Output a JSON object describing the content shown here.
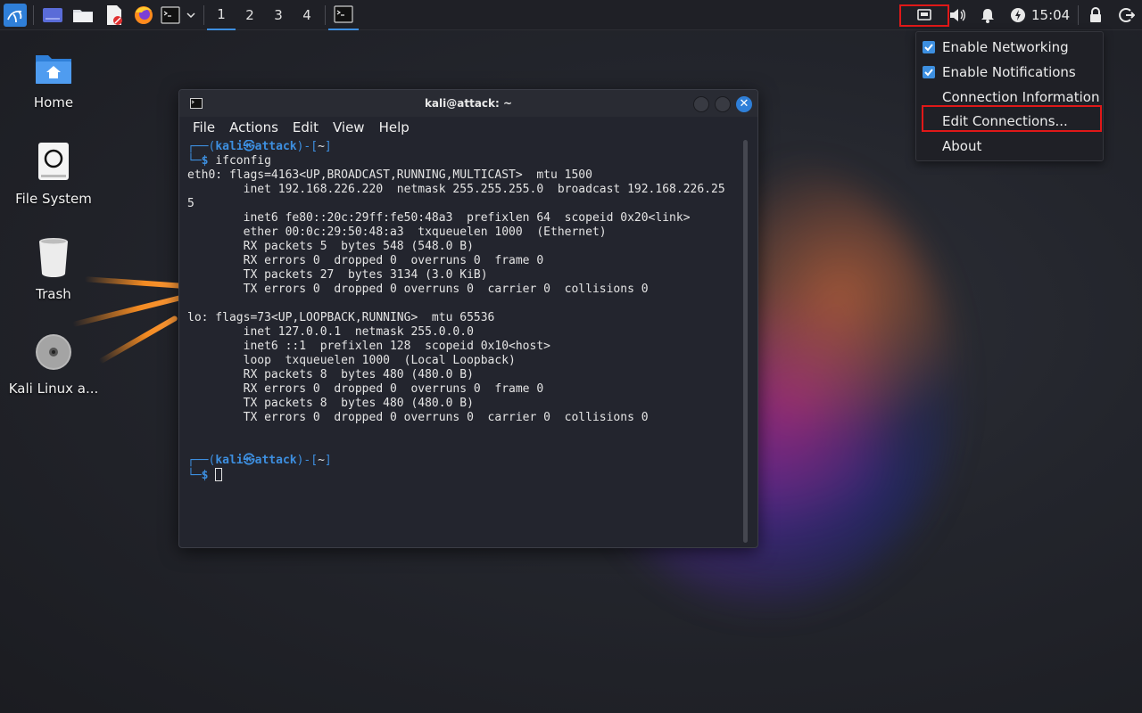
{
  "panel": {
    "workspaces": [
      "1",
      "2",
      "3",
      "4"
    ],
    "active_workspace": "1",
    "clock": "15:04"
  },
  "desktop": {
    "icons": [
      {
        "label": "Home",
        "icon": "home-folder-icon"
      },
      {
        "label": "File System",
        "icon": "drive-icon"
      },
      {
        "label": "Trash",
        "icon": "trash-icon"
      },
      {
        "label": "Kali Linux a...",
        "icon": "disc-icon"
      }
    ]
  },
  "terminal": {
    "title": "kali@attack: ~",
    "menu": [
      "File",
      "Actions",
      "Edit",
      "View",
      "Help"
    ],
    "prompt": {
      "user": "kali",
      "at": "㉿",
      "host": "attack",
      "dir": "~",
      "command": "ifconfig"
    },
    "output": [
      "eth0: flags=4163<UP,BROADCAST,RUNNING,MULTICAST>  mtu 1500",
      "        inet 192.168.226.220  netmask 255.255.255.0  broadcast 192.168.226.25",
      "5",
      "        inet6 fe80::20c:29ff:fe50:48a3  prefixlen 64  scopeid 0x20<link>",
      "        ether 00:0c:29:50:48:a3  txqueuelen 1000  (Ethernet)",
      "        RX packets 5  bytes 548 (548.0 B)",
      "        RX errors 0  dropped 0  overruns 0  frame 0",
      "        TX packets 27  bytes 3134 (3.0 KiB)",
      "        TX errors 0  dropped 0 overruns 0  carrier 0  collisions 0",
      "",
      "lo: flags=73<UP,LOOPBACK,RUNNING>  mtu 65536",
      "        inet 127.0.0.1  netmask 255.0.0.0",
      "        inet6 ::1  prefixlen 128  scopeid 0x10<host>",
      "        loop  txqueuelen 1000  (Local Loopback)",
      "        RX packets 8  bytes 480 (480.0 B)",
      "        RX errors 0  dropped 0  overruns 0  frame 0",
      "        TX packets 8  bytes 480 (480.0 B)",
      "        TX errors 0  dropped 0 overruns 0  carrier 0  collisions 0"
    ]
  },
  "network_menu": {
    "items": [
      {
        "label": "Enable Networking",
        "checked": true
      },
      {
        "label": "Enable Notifications",
        "checked": true
      },
      {
        "label": "Connection Information",
        "checked": false
      },
      {
        "label": "Edit Connections...",
        "checked": false
      },
      {
        "label": "About",
        "checked": false
      }
    ]
  },
  "colors": {
    "accent": "#3d8fe0",
    "highlight": "#e01818",
    "panel_bg": "#1f2026"
  }
}
